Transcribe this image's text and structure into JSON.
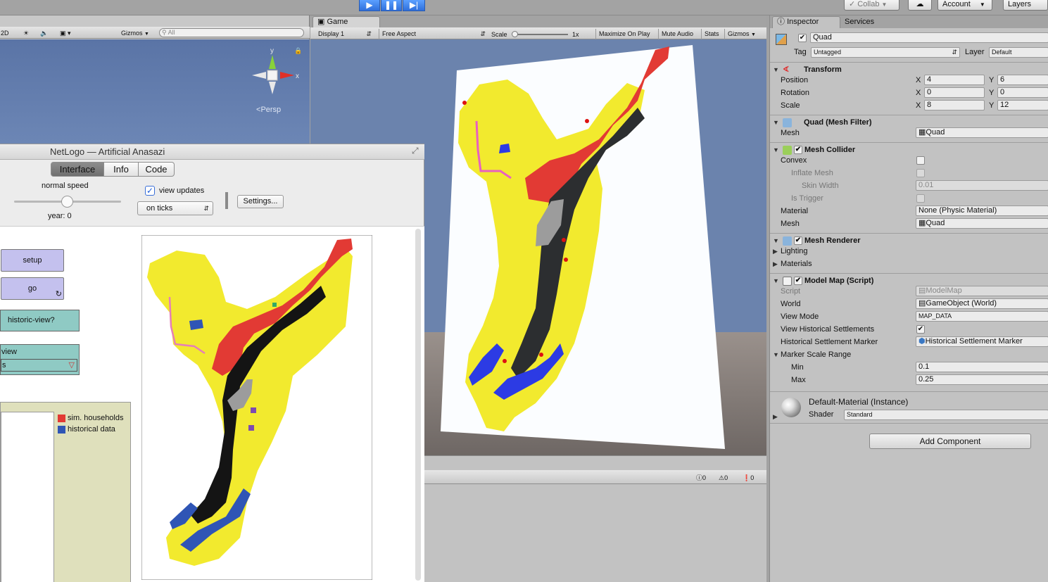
{
  "toolbar": {
    "collab": "Collab",
    "account": "Account",
    "layers": "Layers"
  },
  "scene": {
    "btn_2d": "2D",
    "gizmos": "Gizmos",
    "search_placeholder": "All",
    "x_axis": "x",
    "y_axis": "y",
    "persp": "Persp"
  },
  "game": {
    "tab": "Game",
    "display": "Display 1",
    "aspect": "Free Aspect",
    "scale_label": "Scale",
    "scale_value": "1x",
    "maximize": "Maximize On Play",
    "mute": "Mute Audio",
    "stats": "Stats",
    "gizmos": "Gizmos"
  },
  "console": {
    "info_count": "0",
    "warn_count": "0",
    "error_count": "0"
  },
  "inspector": {
    "tab_inspector": "Inspector",
    "tab_services": "Services",
    "object_name": "Quad",
    "tag_label": "Tag",
    "tag_value": "Untagged",
    "layer_label": "Layer",
    "layer_value": "Default",
    "transform": {
      "title": "Transform",
      "position_label": "Position",
      "rotation_label": "Rotation",
      "scale_label": "Scale",
      "x_label": "X",
      "y_label": "Y",
      "position_x": "4",
      "position_y": "6",
      "rotation_x": "0",
      "rotation_y": "0",
      "scale_x": "8",
      "scale_y": "12"
    },
    "mesh_filter": {
      "title": "Quad (Mesh Filter)",
      "mesh_label": "Mesh",
      "mesh_value": "Quad"
    },
    "mesh_collider": {
      "title": "Mesh Collider",
      "convex": "Convex",
      "inflate_mesh": "Inflate Mesh",
      "skin_width": "Skin Width",
      "skin_width_value": "0.01",
      "is_trigger": "Is Trigger",
      "material_label": "Material",
      "material_value": "None (Physic Material)",
      "mesh_label": "Mesh",
      "mesh_value": "Quad"
    },
    "mesh_renderer": {
      "title": "Mesh Renderer",
      "lighting": "Lighting",
      "materials": "Materials"
    },
    "model_map": {
      "title": "Model Map (Script)",
      "script_label": "Script",
      "script_value": "ModelMap",
      "world_label": "World",
      "world_value": "GameObject (World)",
      "view_mode_label": "View Mode",
      "view_mode_value": "MAP_DATA",
      "view_hist_label": "View Historical Settlements",
      "hist_marker_label": "Historical Settlement Marker",
      "hist_marker_value": "Historical Settlement Marker",
      "marker_range_label": "Marker Scale Range",
      "min_label": "Min",
      "min_value": "0.1",
      "max_label": "Max",
      "max_value": "0.25"
    },
    "material": {
      "name": "Default-Material (Instance)",
      "shader_label": "Shader",
      "shader_value": "Standard"
    },
    "add_component": "Add Component"
  },
  "netlogo": {
    "title": "NetLogo — Artificial Anasazi",
    "tabs": [
      "Interface",
      "Info",
      "Code"
    ],
    "speed_label": "normal speed",
    "year_label": "year: 0",
    "view_updates": "view updates",
    "update_mode": "on ticks",
    "settings": "Settings...",
    "setup": "setup",
    "go": "go",
    "historic_view": "historic-view?",
    "chooser_label": "view",
    "chooser_value": "s",
    "legend": {
      "households": "sim. households",
      "historical": "historical data"
    }
  },
  "colors": {
    "map_yellow": "#f2ea2e",
    "map_red": "#e23a34",
    "map_black": "#141414",
    "map_blue": "#2f55b5",
    "game_bg": "#6b83ad",
    "netlogo_button": "#c4c1ee",
    "netlogo_teal": "#8fcac4"
  }
}
